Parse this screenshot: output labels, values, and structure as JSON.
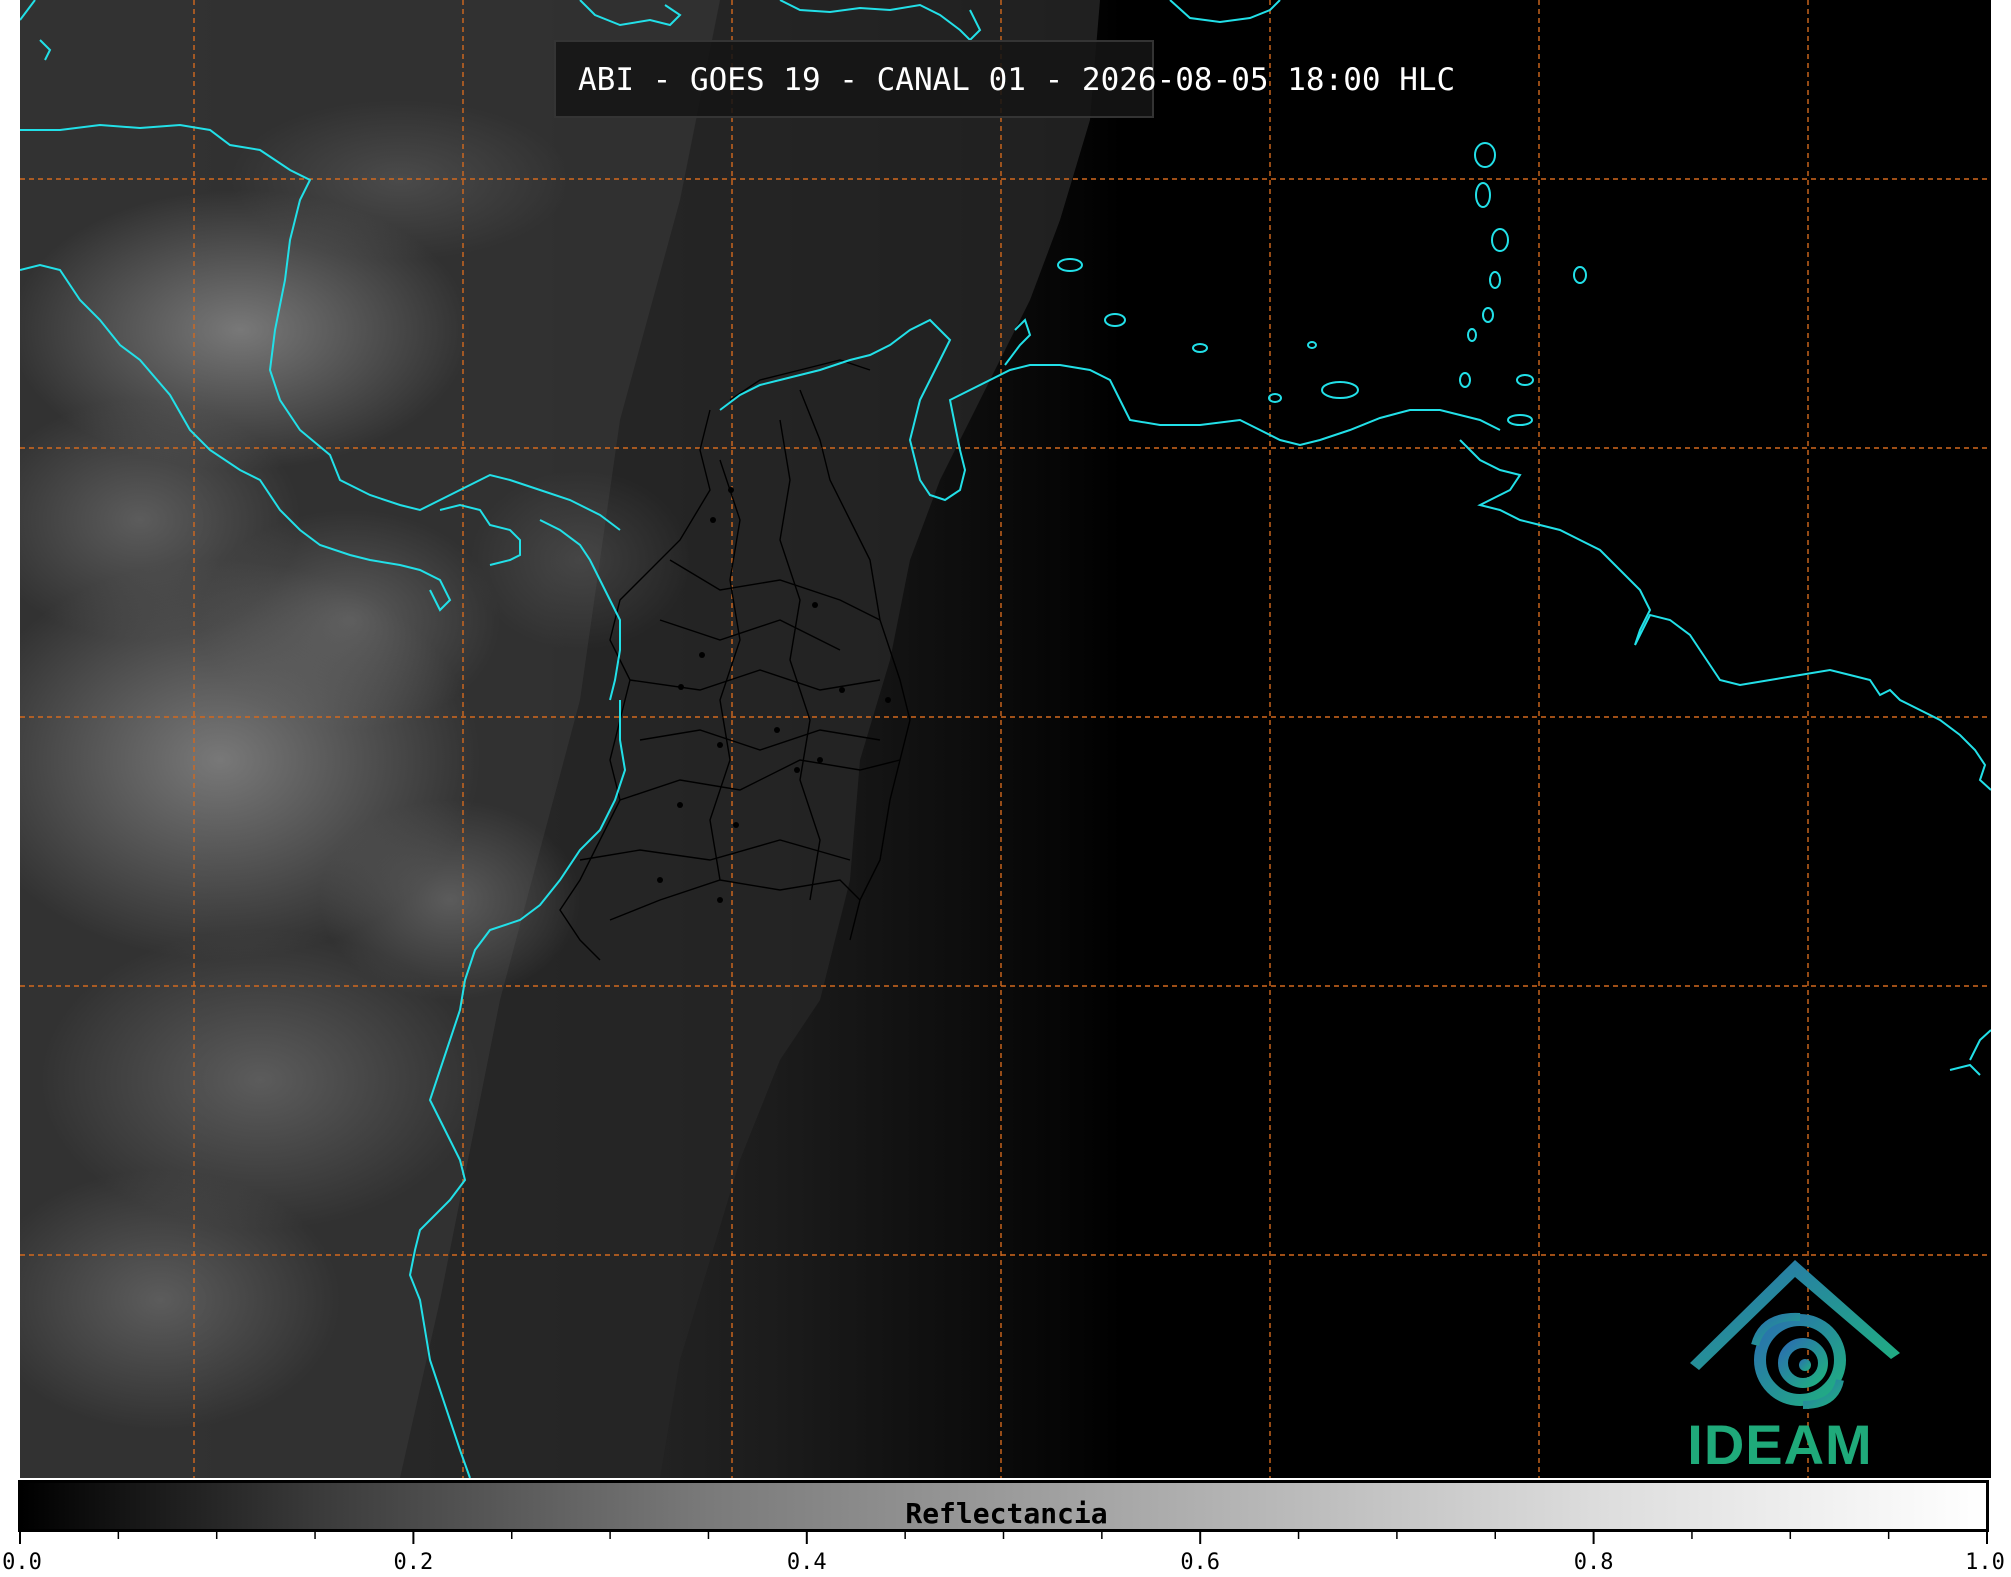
{
  "title": "ABI - GOES 19 - CANAL 01 - 2026-08-05 18:00 HLC",
  "logo": {
    "name": "ideam-logo",
    "text": "IDEAM"
  },
  "colorbar": {
    "label": "Reflectancia",
    "range": [
      0.0,
      1.0
    ],
    "major_ticks": [
      "0.0",
      "0.2",
      "0.4",
      "0.6",
      "0.8",
      "1.0"
    ],
    "minor_tick_step": 0.05,
    "colormap": "grayscale"
  },
  "map": {
    "grid_color": "#d2691e",
    "coastline_color": "#22e0e8",
    "border_color": "#000000",
    "background": "#000000"
  }
}
